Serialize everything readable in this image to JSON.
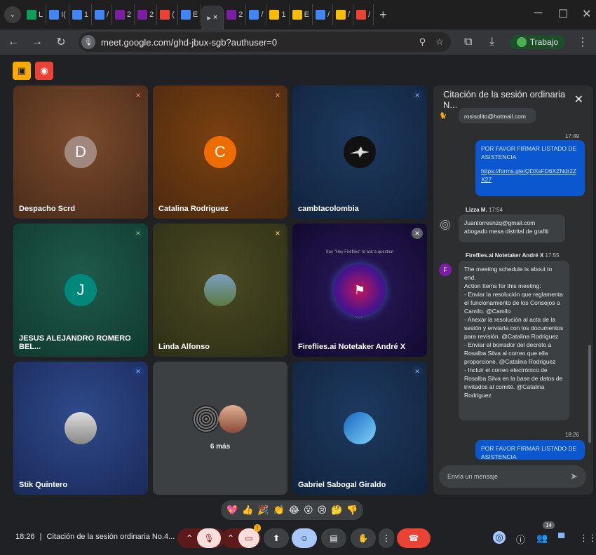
{
  "browser": {
    "tabs": [
      {
        "label": "L",
        "color": "#0f9d58"
      },
      {
        "label": "I(",
        "color": "#4285f4"
      },
      {
        "label": "1",
        "color": "#4285f4"
      },
      {
        "label": "/",
        "color": "#4285f4"
      },
      {
        "label": "2",
        "color": "#7b1fa2"
      },
      {
        "label": "2",
        "color": "#7b1fa2"
      },
      {
        "label": "(",
        "color": "#ea4335"
      },
      {
        "label": "E",
        "color": "#4285f4"
      }
    ],
    "active_tab_close": "×",
    "tabs_right": [
      {
        "label": "2",
        "color": "#7b1fa2"
      },
      {
        "label": "/",
        "color": "#4285f4"
      },
      {
        "label": "1",
        "color": "#fbbc04"
      },
      {
        "label": "E",
        "color": "#fbbc04"
      },
      {
        "label": "/",
        "color": "#4285f4"
      },
      {
        "label": "/",
        "color": "#fbbc04"
      },
      {
        "label": "/",
        "color": "#ea4335"
      }
    ],
    "url": "meet.google.com/ghd-jbux-sgb?authuser=0",
    "profile_label": "Trabajo"
  },
  "tiles": [
    {
      "name": "Despacho Scrd",
      "initial": "D",
      "avatar_color": "#a1887f"
    },
    {
      "name": "Catalina Rodriguez",
      "initial": "C",
      "avatar_color": "#ef6c00"
    },
    {
      "name": "cambtacolombia",
      "initial": "",
      "avatar_color": "#111111"
    },
    {
      "name": "JESUS ALEJANDRO ROMERO BEL...",
      "initial": "J",
      "avatar_color": "#00897b"
    },
    {
      "name": "Linda Alfonso",
      "initial": "",
      "avatar_color": "#6b8e5a"
    },
    {
      "name": "Fireflies.ai Notetaker André X",
      "initial": "",
      "avatar_color": "#7b1fa2"
    },
    {
      "name": "Stik Quintero",
      "initial": "",
      "avatar_color": "#90a4ae"
    },
    {
      "name": "6 más",
      "initial": "",
      "avatar_color": "#555"
    },
    {
      "name": "Gabriel Sabogal Giraldo",
      "initial": "",
      "avatar_color": "#1565c0"
    }
  ],
  "fireflies_prompt": "Say \"Hey Fireflies\" to ask a question",
  "chat": {
    "title": "Citación de la sesión ordinaria N...",
    "messages": {
      "email1": "rosisolito@hotmail.com",
      "time1": "17:49",
      "msg1_line1": "POR FAVOR FIRMAR LISTADO DE",
      "msg1_line2": "ASISTENCIA",
      "msg1_link": "https://forms.gle/QDXsFD6XZNdr2ZX27",
      "sender2": "Lizza M.",
      "time2": "17:54",
      "msg2_line1": "Juantorresnzq@gmail.com",
      "msg2_line2": "abogado mesa distrital de grafiti",
      "sender3": "Fireflies.ai Notetaker André X",
      "time3": "17:55",
      "msg3": "The meeting schedule is about to end.\nAction Items for this meeting:\n- Enviar la resolución que reglamenta el funcionamiento de los Consejos a Camilo. @Camilo\n- Anexar la resolución al acta de la sesión y enviarla con los documentos para revisión. @Catalina Rodriguez\n- Enviar el borrador del decreto a Rosalba Silva al correo que ella proporcione. @Catalina Rodriguez\n- Incluir el correo electrónico de Rosalba Silva en la base de datos de invitados al comité. @Catalina Rodriguez",
      "time4": "18:26",
      "msg4_line1": "POR FAVOR FIRMAR LISTADO DE",
      "msg4_line2": "ASISTENCIA"
    },
    "input_placeholder": "Envía un mensaje"
  },
  "reactions": [
    "💖",
    "👍",
    "🎉",
    "👏",
    "😂",
    "😮",
    "😢",
    "🤔",
    "👎"
  ],
  "bottom": {
    "time": "18:26",
    "separator": "|",
    "meeting_title": "Citación de la sesión ordinaria No.4...",
    "camera_badge": "!",
    "participants_count": "14"
  },
  "colors": {
    "accent_blue": "#a8c7fa",
    "end_call": "#ea4335",
    "mic_off_bg": "#f9dedc"
  }
}
